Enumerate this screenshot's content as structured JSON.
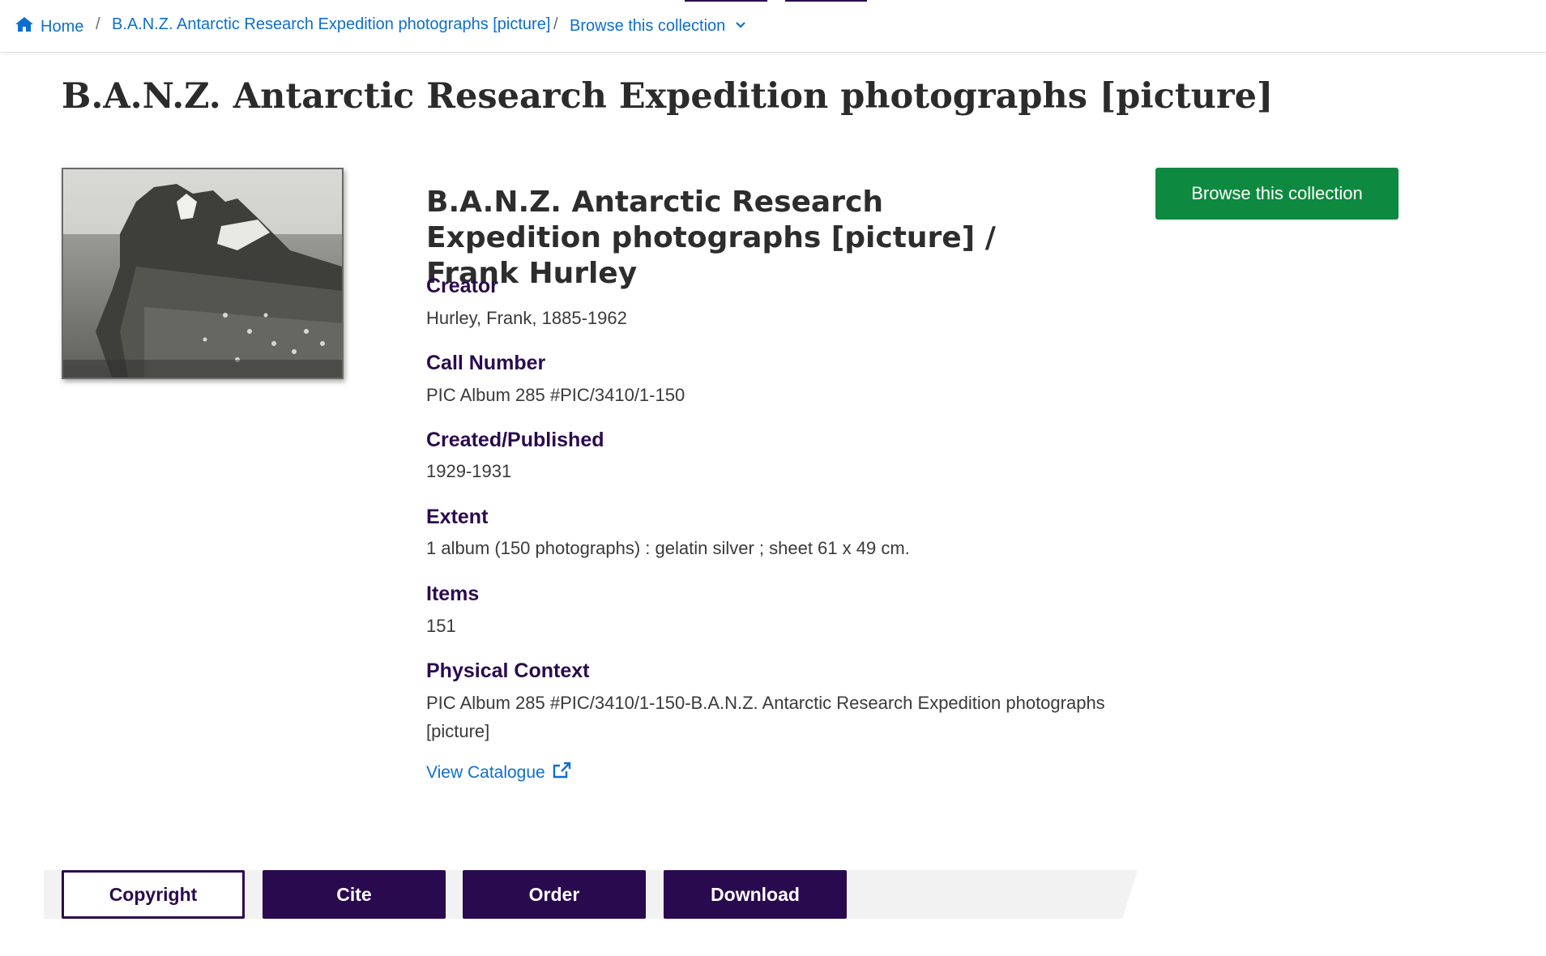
{
  "breadcrumb": {
    "home": "Home",
    "separator": "/",
    "collection": "B.A.N.Z. Antarctic Research Expedition photographs [picture]",
    "browse": "Browse this collection"
  },
  "page_title": "B.A.N.Z. Antarctic Research Expedition photographs [picture]",
  "record": {
    "heading": "B.A.N.Z. Antarctic Research Expedition photographs [picture] / Frank Hurley",
    "fields": [
      {
        "label": "Creator",
        "value": "Hurley, Frank, 1885-1962"
      },
      {
        "label": "Call Number",
        "value": "PIC Album 285 #PIC/3410/1-150"
      },
      {
        "label": "Created/Published",
        "value": "1929-1931"
      },
      {
        "label": "Extent",
        "value": "1 album (150 photographs) : gelatin silver ; sheet 61 x 49 cm."
      },
      {
        "label": "Items",
        "value": "151"
      },
      {
        "label": "Physical Context",
        "value": "PIC Album 285 #PIC/3410/1-150-B.A.N.Z. Antarctic Research Expedition photographs [picture]"
      }
    ],
    "view_catalogue": "View Catalogue"
  },
  "browse_button": "Browse this collection",
  "actions": {
    "copyright": "Copyright",
    "cite": "Cite",
    "order": "Order",
    "download": "Download"
  },
  "icons": {
    "home": "home-icon",
    "chevron": "chevron-down-icon",
    "external": "external-link-icon"
  },
  "colors": {
    "link": "#0d6ed1",
    "label_purple": "#2a0a4f",
    "browse_green": "#0d8a3f",
    "action_band": "#f2f2f2"
  }
}
